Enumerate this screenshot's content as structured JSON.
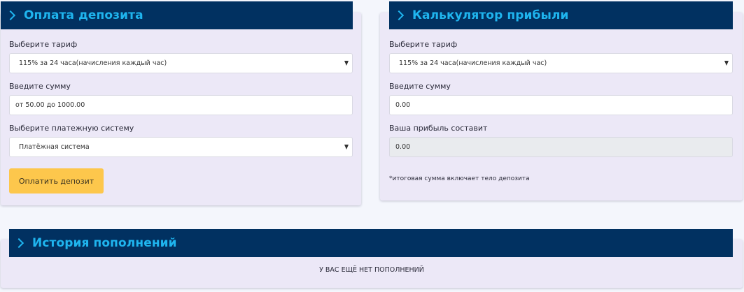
{
  "deposit": {
    "title": "Оплата депозита",
    "tariff_label": "Выберите тариф",
    "tariff_value": "115% за 24 часа(начисления каждый час)",
    "amount_label": "Введите сумму",
    "amount_placeholder": "от 50.00 до 1000.00",
    "payment_label": "Выберите платежную систему",
    "payment_value": "Платёжная система",
    "pay_button": "Оплатить депозит"
  },
  "calculator": {
    "title": "Калькулятор прибыли",
    "tariff_label": "Выберите тариф",
    "tariff_value": "115% за 24 часа(начисления каждый час)",
    "amount_label": "Введите сумму",
    "amount_value": "0.00",
    "profit_label": "Ваша прибыль составит",
    "profit_value": "0.00",
    "note": "*итоговая сумма включает тело депозита"
  },
  "history": {
    "title": "История пополнений",
    "empty_text": "У ВАС ЕЩЁ НЕТ ПОПОЛНЕНИЙ"
  },
  "colors": {
    "header_bg": "#013161",
    "header_text": "#1fb5ef",
    "card_bg": "#ece8f7",
    "button_bg": "#fdc74c"
  }
}
